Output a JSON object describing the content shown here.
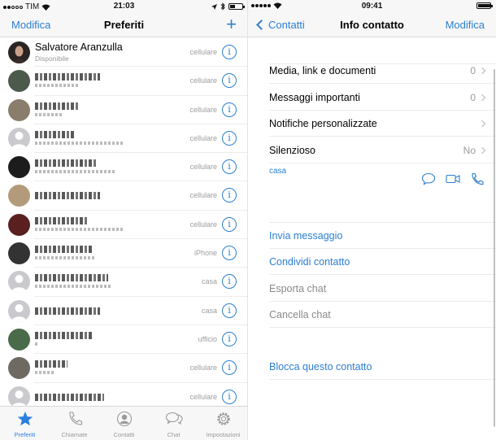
{
  "left": {
    "status": {
      "carrier": "TIM",
      "time": "21:03",
      "signal_bars": 2
    },
    "nav": {
      "left_button": "Modifica",
      "title": "Preferiti",
      "right_button": "+"
    },
    "favorites": [
      {
        "name": "Salvatore Aranzulla",
        "subtitle": "Disponibile",
        "label": "cellulare",
        "obscured": false,
        "avatar_color": "#2a2422"
      },
      {
        "name": "",
        "subtitle": "",
        "label": "cellulare",
        "obscured": true,
        "avatar_color": "#4c5a4c"
      },
      {
        "name": "",
        "subtitle": "",
        "label": "cellulare",
        "obscured": true,
        "avatar_color": "#8a7d6c"
      },
      {
        "name": "",
        "subtitle": "",
        "label": "cellulare",
        "obscured": true,
        "avatar_color": "#c9c9ce"
      },
      {
        "name": "",
        "subtitle": "",
        "label": "cellulare",
        "obscured": true,
        "avatar_color": "#1c1c1c"
      },
      {
        "name": "",
        "subtitle": "",
        "label": "cellulare",
        "obscured": true,
        "avatar_color": "#b39a7a"
      },
      {
        "name": "",
        "subtitle": "",
        "label": "cellulare",
        "obscured": true,
        "avatar_color": "#5a1f1f"
      },
      {
        "name": "",
        "subtitle": "",
        "label": "iPhone",
        "obscured": true,
        "avatar_color": "#333333"
      },
      {
        "name": "",
        "subtitle": "",
        "label": "casa",
        "obscured": true,
        "avatar_color": "#c9c9ce"
      },
      {
        "name": "",
        "subtitle": "",
        "label": "casa",
        "obscured": true,
        "avatar_color": "#c9c9ce"
      },
      {
        "name": "",
        "subtitle": "",
        "label": "ufficio",
        "obscured": true,
        "avatar_color": "#4a6b4a"
      },
      {
        "name": "",
        "subtitle": "",
        "label": "cellulare",
        "obscured": true,
        "avatar_color": "#6e6a62"
      },
      {
        "name": "",
        "subtitle": "",
        "label": "cellulare",
        "obscured": true,
        "avatar_color": "#c9c9ce"
      }
    ],
    "tabs": [
      {
        "label": "Preferiti",
        "icon": "star-icon",
        "active": true
      },
      {
        "label": "Chiamate",
        "icon": "phone-icon",
        "active": false
      },
      {
        "label": "Contatti",
        "icon": "contact-icon",
        "active": false
      },
      {
        "label": "Chat",
        "icon": "chat-bubbles-icon",
        "active": false
      },
      {
        "label": "Impostazioni",
        "icon": "gear-icon",
        "active": false
      }
    ],
    "info_glyph": "i"
  },
  "right": {
    "status": {
      "time": "09:41",
      "signal_bars": 5
    },
    "nav": {
      "back_label": "Contatti",
      "title": "Info contatto",
      "right_button": "Modifica"
    },
    "settings_rows": [
      {
        "label": "Media, link e documenti",
        "value": "0"
      },
      {
        "label": "Messaggi importanti",
        "value": "0"
      },
      {
        "label": "Notifiche personalizzate",
        "value": ""
      },
      {
        "label": "Silenzioso",
        "value": "No"
      }
    ],
    "phone_label": "casa",
    "actions": [
      {
        "label": "Invia messaggio",
        "style": "action"
      },
      {
        "label": "Condividi contatto",
        "style": "action"
      },
      {
        "label": "Esporta chat",
        "style": "gray"
      },
      {
        "label": "Cancella chat",
        "style": "gray"
      }
    ],
    "block_label": "Blocca questo contatto"
  },
  "colors": {
    "accent": "#2c7fd1",
    "tab_active": "#2b7fe0",
    "secondary_text": "#9a9a9a"
  }
}
